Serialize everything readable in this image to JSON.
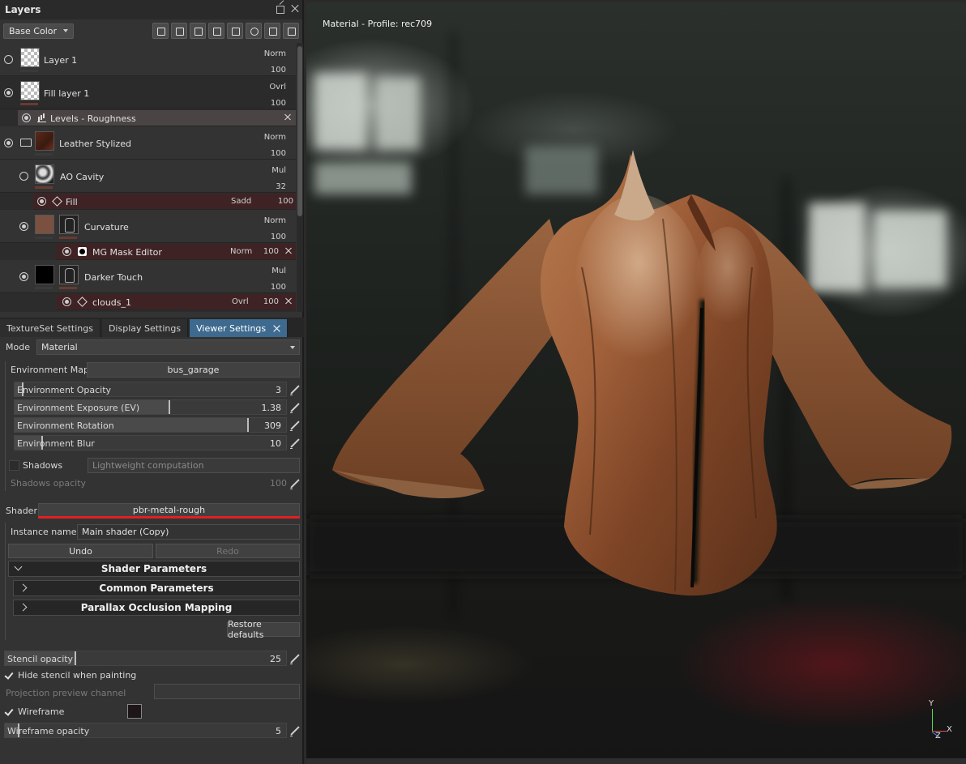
{
  "layers_panel": {
    "title": "Layers",
    "channel": "Base Color",
    "layers": [
      {
        "name": "Layer 1",
        "blend": "Norm",
        "opacity": "100"
      },
      {
        "name": "Fill layer 1",
        "blend": "Ovrl",
        "opacity": "100"
      },
      {
        "name": "Levels - Roughness"
      },
      {
        "name": "Leather Stylized",
        "blend": "Norm",
        "opacity": "100"
      },
      {
        "name": "AO Cavity",
        "blend": "Mul",
        "opacity": "32"
      },
      {
        "name": "Fill",
        "blend": "Sadd",
        "opacity": "100"
      },
      {
        "name": "Curvature",
        "blend": "Norm",
        "opacity": "100"
      },
      {
        "name": "MG Mask Editor",
        "blend": "Norm",
        "opacity": "100"
      },
      {
        "name": "Darker Touch",
        "blend": "Mul",
        "opacity": "100"
      },
      {
        "name": "clouds_1",
        "blend": "Ovrl",
        "opacity": "100"
      }
    ]
  },
  "tabs": [
    {
      "label": "TextureSet Settings"
    },
    {
      "label": "Display Settings"
    },
    {
      "label": "Viewer Settings"
    }
  ],
  "viewer_settings": {
    "mode_label": "Mode",
    "mode_value": "Material",
    "env_map_label": "Environment Map",
    "env_map_value": "bus_garage",
    "env_opacity": {
      "label": "Environment Opacity",
      "value": "3",
      "fraction": 0.03
    },
    "env_exposure": {
      "label": "Environment Exposure (EV)",
      "value": "1.38",
      "fraction": 0.57
    },
    "env_rotation": {
      "label": "Environment Rotation",
      "value": "309",
      "fraction": 0.86
    },
    "env_blur": {
      "label": "Environment Blur",
      "value": "10",
      "fraction": 0.1
    },
    "shadows_label": "Shadows",
    "shadows_mode": "Lightweight computation",
    "shadows_opacity": {
      "label": "Shadows opacity",
      "value": "100"
    },
    "shader_label": "Shader",
    "shader_value": "pbr-metal-rough",
    "instance_label": "Instance name",
    "instance_value": "Main shader (Copy)",
    "undo": "Undo",
    "redo": "Redo",
    "shader_params": "Shader Parameters",
    "common_params": "Common Parameters",
    "parallax": "Parallax Occlusion Mapping",
    "restore": "Restore defaults",
    "stencil_opacity": {
      "label": "Stencil opacity",
      "value": "25",
      "fraction": 0.25
    },
    "hide_stencil": "Hide stencil when painting",
    "projection_channel": "Projection preview channel",
    "wireframe": "Wireframe",
    "wireframe_color": "#1e1616",
    "wireframe_opacity": {
      "label": "Wireframe opacity",
      "value": "5",
      "fraction": 0.05
    }
  },
  "viewport": {
    "label": "Material - Profile: rec709",
    "axis_y": "Y",
    "axis_x": "X",
    "axis_z": "Z"
  }
}
